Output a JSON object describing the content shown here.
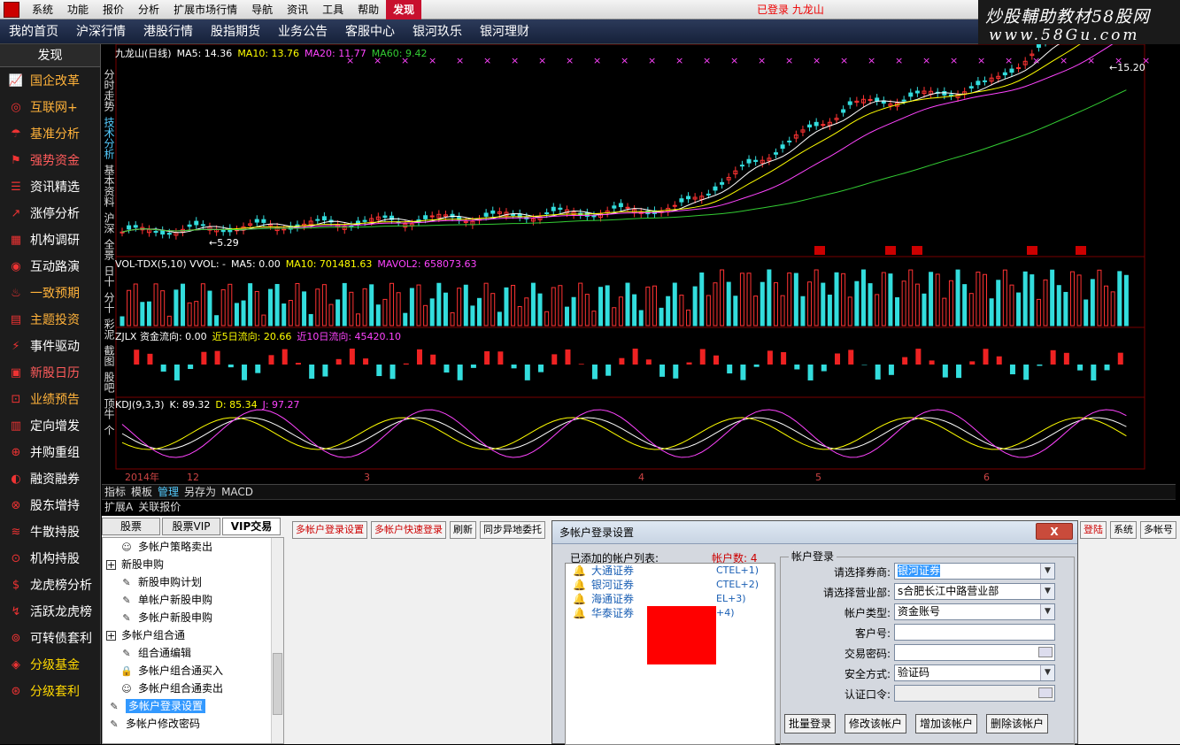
{
  "menubar": {
    "items": [
      "系统",
      "功能",
      "报价",
      "分析",
      "扩展市场行情",
      "导航",
      "资讯",
      "工具",
      "帮助",
      "发现"
    ],
    "status": "已登录 九龙山"
  },
  "watermark": {
    "line1": "炒股輔助教材58股网",
    "line2": "www.58Gu.com"
  },
  "navbar": {
    "items": [
      "我的首页",
      "沪深行情",
      "港股行情",
      "股指期货",
      "业务公告",
      "客服中心",
      "银河玖乐",
      "银河理财"
    ]
  },
  "sidebar": {
    "title": "发现",
    "items": [
      {
        "label": "国企改革",
        "color": "orange"
      },
      {
        "label": "互联网+",
        "color": "orange"
      },
      {
        "label": "基准分析",
        "color": "orange"
      },
      {
        "label": "强势资金",
        "color": "red"
      },
      {
        "label": "资讯精选",
        "color": "white"
      },
      {
        "label": "涨停分析",
        "color": "white"
      },
      {
        "label": "机构调研",
        "color": "white"
      },
      {
        "label": "互动路演",
        "color": "white"
      },
      {
        "label": "一致预期",
        "color": "orange"
      },
      {
        "label": "主题投资",
        "color": "orange"
      },
      {
        "label": "事件驱动",
        "color": "white"
      },
      {
        "label": "新股日历",
        "color": "red"
      },
      {
        "label": "业绩预告",
        "color": "orange"
      },
      {
        "label": "定向增发",
        "color": "white"
      },
      {
        "label": "并购重组",
        "color": "white"
      },
      {
        "label": "融资融券",
        "color": "white"
      },
      {
        "label": "股东增持",
        "color": "white"
      },
      {
        "label": "牛散持股",
        "color": "white"
      },
      {
        "label": "机构持股",
        "color": "white"
      },
      {
        "label": "龙虎榜分析",
        "color": "white"
      },
      {
        "label": "活跃龙虎榜",
        "color": "white"
      },
      {
        "label": "可转债套利",
        "color": "white"
      },
      {
        "label": "分级基金",
        "color": "yellow"
      },
      {
        "label": "分级套利",
        "color": "yellow"
      }
    ]
  },
  "chart_vtabs": [
    "分时走势",
    "技术分析",
    "基本资料",
    "沪深",
    "全景",
    "日十",
    "分十",
    "彩泥",
    "截图",
    "股吧",
    "顶牛",
    "个"
  ],
  "price_panel": {
    "name": "九龙山(日线)",
    "ma5": "MA5: 14.36",
    "ma10": "MA10: 13.76",
    "ma20": "MA20: 11.77",
    "ma60": "MA60: 9.42",
    "high_label": "15.20",
    "low_label": "5.29"
  },
  "vol_panel": {
    "name": "VOL-TDX(5,10) VVOL: -",
    "ma5": "MA5: 0.00",
    "ma10": "MA10: 701481.63",
    "mavol2": "MAVOL2: 658073.63"
  },
  "zjlx_panel": {
    "name": "ZJLX 资金流向: 0.00",
    "d5": "近5日流向: 20.66",
    "d10": "近10日流向: 45420.10"
  },
  "kdj_panel": {
    "name": "KDJ(9,3,3)",
    "k": "K: 89.32",
    "d": "D: 85.34",
    "j": "J: 97.27"
  },
  "x_axis": [
    "2014年",
    "12",
    "3",
    "4",
    "5",
    "6"
  ],
  "chart_tabs": [
    "指标",
    "模板",
    "管理",
    "另存为",
    "MACD"
  ],
  "ext_bar": [
    "扩展A",
    "关联报价"
  ],
  "trade_tabs": [
    "股票",
    "股票VIP",
    "VIP交易"
  ],
  "tree": [
    {
      "label": "多帐户策略卖出",
      "level": 1,
      "icon": "person"
    },
    {
      "label": "新股申购",
      "level": 0,
      "icon": "plus"
    },
    {
      "label": "新股申购计划",
      "level": 1,
      "icon": "wrench"
    },
    {
      "label": "单帐户新股申购",
      "level": 1,
      "icon": "wrench"
    },
    {
      "label": "多帐户新股申购",
      "level": 1,
      "icon": "wrench"
    },
    {
      "label": "多帐户组合通",
      "level": 0,
      "icon": "plus"
    },
    {
      "label": "组合通编辑",
      "level": 1,
      "icon": "wrench"
    },
    {
      "label": "多帐户组合通买入",
      "level": 1,
      "icon": "lock"
    },
    {
      "label": "多帐户组合通卖出",
      "level": 1,
      "icon": "person"
    },
    {
      "label": "多帐户登录设置",
      "level": 0,
      "icon": "wrench",
      "selected": true
    },
    {
      "label": "多帐户修改密码",
      "level": 0,
      "icon": "wrench"
    }
  ],
  "toolbar": [
    "多帐户登录设置",
    "多帐户快速登录",
    "刷新",
    "同步异地委托"
  ],
  "toolbar_right": [
    "登陆",
    "系统",
    "多帐号"
  ],
  "dialog": {
    "title": "多帐户登录设置",
    "close": "X",
    "list_label": "已添加的帐户列表:",
    "count": "帐户数: 4",
    "accounts": [
      {
        "name": "大通证券",
        "hotkey": "CTEL+1)"
      },
      {
        "name": "银河证券",
        "hotkey": "CTEL+2)"
      },
      {
        "name": "海通证券",
        "hotkey": "EL+3)"
      },
      {
        "name": "华泰证券",
        "hotkey": "+4)"
      }
    ],
    "legend": "帐户登录",
    "fields": [
      {
        "label": "请选择券商:",
        "value": "银河证券",
        "type": "select",
        "highlight": true
      },
      {
        "label": "请选择营业部:",
        "value": "s合肥长江中路营业部",
        "type": "select"
      },
      {
        "label": "帐户类型:",
        "value": "资金账号",
        "type": "select"
      },
      {
        "label": "客户号:",
        "value": "",
        "type": "text"
      },
      {
        "label": "交易密码:",
        "value": "",
        "type": "password"
      },
      {
        "label": "安全方式:",
        "value": "验证码",
        "type": "select"
      },
      {
        "label": "认证口令:",
        "value": "",
        "type": "password",
        "disabled": true
      }
    ],
    "buttons": [
      "批量登录",
      "修改该帐户",
      "增加该帐户",
      "删除该帐户"
    ]
  },
  "colors": {
    "up": "#ff3333",
    "down": "#33dddd",
    "ma5": "#ffffff",
    "ma10": "#ffff00",
    "ma20": "#ff44ff",
    "ma60": "#33cc33"
  }
}
